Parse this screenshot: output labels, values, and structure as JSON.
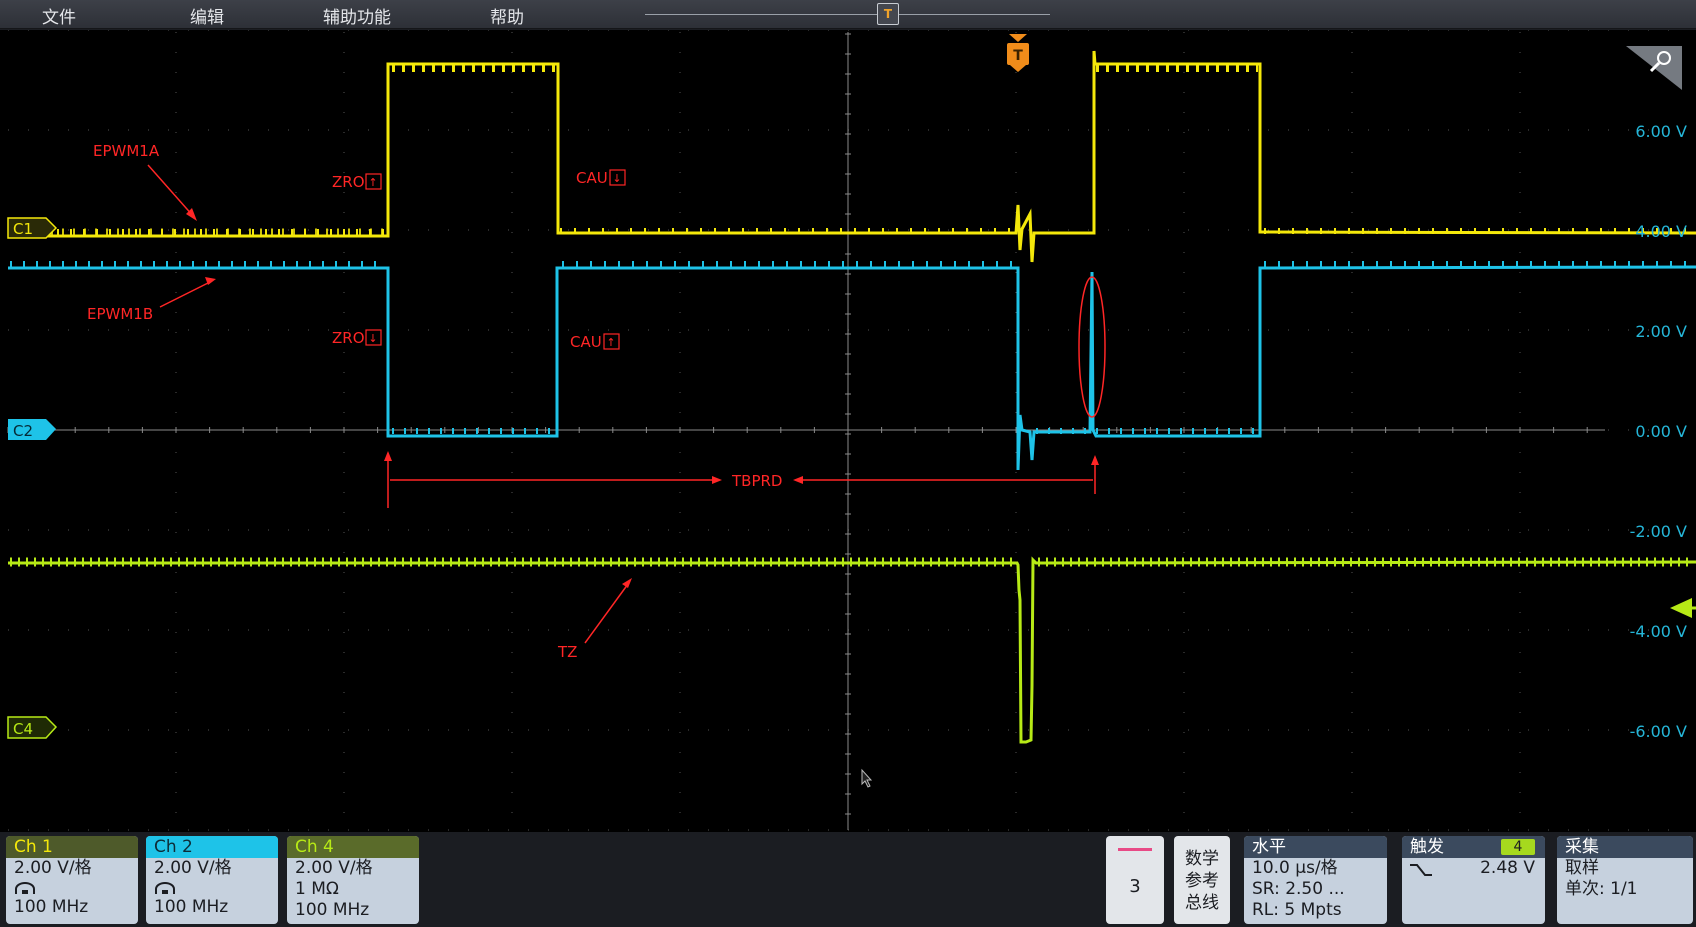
{
  "menubar": {
    "items": [
      "文件",
      "编辑",
      "辅助功能",
      "帮助"
    ],
    "trigger_marker": "T"
  },
  "colors": {
    "ch1": "#f4e80a",
    "ch2": "#1ec3e8",
    "ch4": "#b7ea16",
    "annotation": "#ff2626",
    "voltage_label": "#25b6d8"
  },
  "screen": {
    "channel_markers": [
      {
        "id": "ch1",
        "label": "C1"
      },
      {
        "id": "ch2",
        "label": "C2"
      },
      {
        "id": "ch4",
        "label": "C4"
      }
    ],
    "voltage_labels": [
      "6.00 V",
      "4.00 V",
      "2.00 V",
      "0.00 V",
      "-2.00 V",
      "-4.00 V",
      "-6.00 V"
    ],
    "trigger_position_marker": "T",
    "annotations": {
      "epwm1a": "EPWM1A",
      "epwm1b": "EPWM1B",
      "zro_up": "ZRO",
      "zro_down": "ZRO",
      "cau_down": "CAU",
      "cau_up": "CAU",
      "tbprd": "TBPRD",
      "tz": "TZ"
    }
  },
  "bottom": {
    "ch1": {
      "title": "Ch 1",
      "volts_per_div": "2.00 V/格",
      "bandwidth": "100 MHz"
    },
    "ch2": {
      "title": "Ch 2",
      "volts_per_div": "2.00 V/格",
      "bandwidth": "100 MHz"
    },
    "ch4": {
      "title": "Ch 4",
      "volts_per_div": "2.00 V/格",
      "impedance": "1 MΩ",
      "bandwidth": "100 MHz"
    },
    "add_tile": {
      "label": "3"
    },
    "math_ref_bus": {
      "lines": [
        "数学",
        "参考",
        "总线"
      ]
    },
    "horizontal": {
      "title": "水平",
      "scale": "10.0 μs/格",
      "sample_rate": "SR: 2.50 ...",
      "record_length": "RL: 5 Mpts"
    },
    "trigger": {
      "title": "触发",
      "source": "4",
      "level": "2.48 V"
    },
    "acquisition": {
      "title": "采集",
      "mode": "取样",
      "count": "单次: 1/1"
    }
  }
}
